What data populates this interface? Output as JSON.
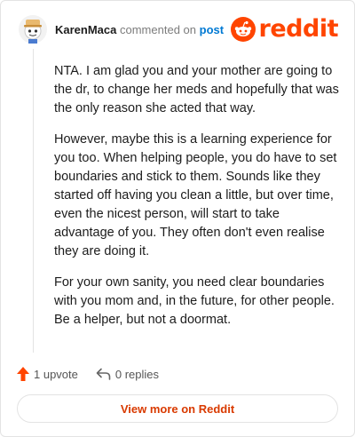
{
  "header": {
    "author": "KarenMaca",
    "commented_text": "commented on",
    "post_link": "post",
    "logo_text": "reddit"
  },
  "comment": {
    "paragraphs": [
      "NTA. I am glad you and your mother are going to the dr, to change her meds and hopefully that was the only reason she acted that way.",
      "However, maybe this is a learning experience for you too. When helping people, you do have to set boundaries and stick to them. Sounds like they started off having you clean a little, but over time, even the nicest person, will start to take advantage of you. They often don't even realise they are doing it.",
      "For your own sanity, you need clear boundaries with you mom and, in the future, for other people. Be a helper, but not a doormat."
    ]
  },
  "actions": {
    "upvotes": "1 upvote",
    "replies": "0 replies"
  },
  "footer": {
    "view_more": "View more on Reddit"
  },
  "colors": {
    "brand": "#ff4500",
    "link": "#0079d3",
    "view_more": "#d93a00"
  }
}
